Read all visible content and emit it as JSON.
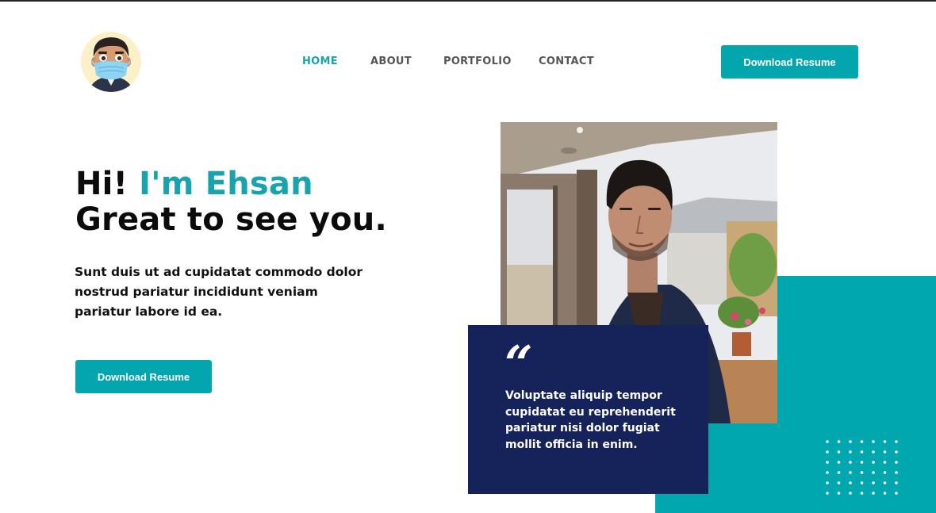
{
  "header": {
    "nav": [
      {
        "label": "HOME",
        "active": true
      },
      {
        "label": "ABOUT",
        "active": false
      },
      {
        "label": "PORTFOLIO",
        "active": false
      },
      {
        "label": "CONTACT",
        "active": false
      }
    ],
    "cta_label": "Download Resume"
  },
  "hero": {
    "greeting": "Hi!",
    "name": "I'm Ehsan",
    "subtitle": "Great to see you.",
    "lead": "Sunt duis ut ad cupidatat commodo dolor nostrud pariatur incididunt veniam pariatur labore id ea.",
    "cta_label": "Download Resume"
  },
  "quote": {
    "mark": "“",
    "text": "Voluptate aliquip tempor cupidatat eu reprehenderit pariatur nisi dolor fugiat mollit officia in enim."
  },
  "colors": {
    "accent": "#03a5ae",
    "navy": "#16225a",
    "text": "#111111",
    "nav_text": "#555555"
  },
  "icons": {
    "avatar": "cartoon-avatar-with-mask",
    "quote": "quote-mark-icon",
    "dots": "dot-grid-decoration"
  }
}
